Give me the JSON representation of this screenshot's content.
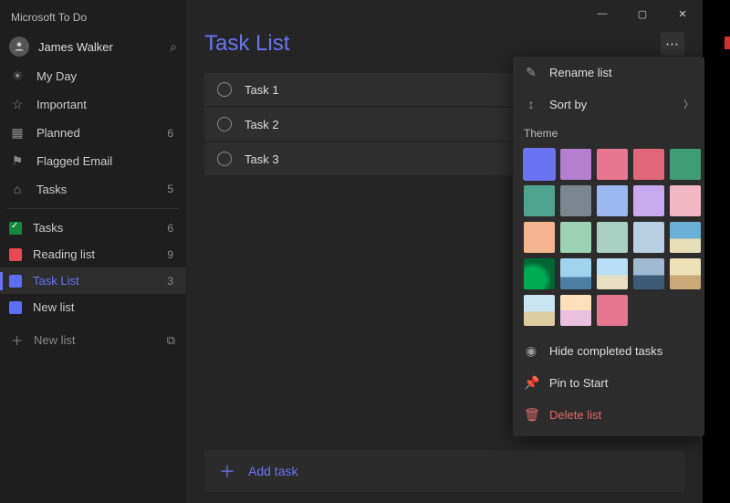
{
  "app_title": "Microsoft To Do",
  "user": {
    "name": "James Walker"
  },
  "window_controls": {
    "minimize": "—",
    "maximize": "▢",
    "close": "✕"
  },
  "sidebar": {
    "default_lists": [
      {
        "icon": "☀",
        "label": "My Day",
        "count": ""
      },
      {
        "icon": "☆",
        "label": "Important",
        "count": ""
      },
      {
        "icon": "▦",
        "label": "Planned",
        "count": "6"
      },
      {
        "icon": "⚑",
        "label": "Flagged Email",
        "count": ""
      },
      {
        "icon": "⌂",
        "label": "Tasks",
        "count": "5"
      }
    ],
    "custom_lists": [
      {
        "style": "green",
        "label": "Tasks",
        "count": "6",
        "selected": false
      },
      {
        "style": "red",
        "label": "Reading list",
        "count": "9",
        "selected": false
      },
      {
        "style": "blue",
        "label": "Task List",
        "count": "3",
        "selected": true
      },
      {
        "style": "blue",
        "label": "New list",
        "count": "",
        "selected": false
      }
    ],
    "new_list_label": "New list",
    "search_icon": "⌕"
  },
  "main": {
    "list_title": "Task List",
    "more_label": "⋯",
    "tasks": [
      {
        "title": "Task 1"
      },
      {
        "title": "Task 2"
      },
      {
        "title": "Task 3"
      }
    ],
    "add_task_label": "Add task"
  },
  "context_menu": {
    "rename": "Rename list",
    "sortby": "Sort by",
    "theme_header": "Theme",
    "swatches": [
      {
        "c": "#6a74f3",
        "sel": true
      },
      {
        "c": "#b57ed0"
      },
      {
        "c": "#e87691"
      },
      {
        "c": "#e3677a"
      },
      {
        "c": "#3f9d75"
      },
      {
        "c": "#4ea48e"
      },
      {
        "c": "#7a8790"
      },
      {
        "c": "#9bb9f0"
      },
      {
        "c": "#c8a9ef"
      },
      {
        "c": "#f2b7c4"
      },
      {
        "c": "#f3b48e"
      },
      {
        "c": "#9cd3b5"
      },
      {
        "c": "#a9cfc3"
      },
      {
        "c": "#b9d0e3"
      },
      {
        "c": "#photo1"
      },
      {
        "c": "#photo2"
      },
      {
        "c": "#photo3"
      },
      {
        "c": "#photo4"
      },
      {
        "c": "#photo5"
      },
      {
        "c": "#photo6"
      },
      {
        "c": "#photo7"
      },
      {
        "c": "#photo8"
      },
      {
        "c": "#e87691"
      }
    ],
    "hide_completed": "Hide completed tasks",
    "pin": "Pin to Start",
    "delete": "Delete list"
  }
}
